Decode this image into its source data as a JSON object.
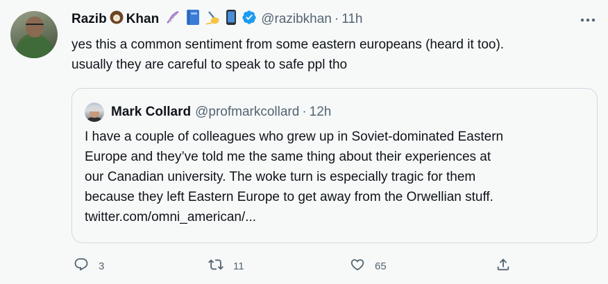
{
  "author": {
    "name_first": "Razib",
    "name_last": "Khan",
    "handle": "@razibkhan",
    "time": "11h",
    "verified": true
  },
  "tweet_text": [
    "yes this a common sentiment from some eastern europeans (heard it too).",
    "usually they are careful to speak to safe ppl tho"
  ],
  "quote": {
    "name": "Mark Collard",
    "handle": "@profmarkcollard",
    "time": "12h",
    "text": [
      "I have a couple of colleagues who grew up in Soviet-dominated Eastern",
      "Europe and they’ve told me the same thing about their experiences at",
      "our Canadian university. The woke turn is especially tragic for them",
      "because they left Eastern Europe to get away from the Orwellian stuff.",
      "twitter.com/omni_american/..."
    ]
  },
  "actions": {
    "reply_count": "3",
    "retweet_count": "11",
    "like_count": "65"
  },
  "icons": {
    "name_emojis": [
      "coconut-icon",
      "dna-icon",
      "book-icon",
      "writing-hand-icon",
      "mobile-phone-icon"
    ],
    "verified": "verified-badge-icon",
    "more": "more-dots-icon",
    "reply": "reply-icon",
    "retweet": "retweet-icon",
    "like": "heart-icon",
    "share": "share-icon"
  },
  "colors": {
    "background": "#f7f9f9",
    "text_primary": "#0f1419",
    "text_secondary": "#536471",
    "verified_blue": "#1d9bf0",
    "border": "#cfd9de"
  }
}
